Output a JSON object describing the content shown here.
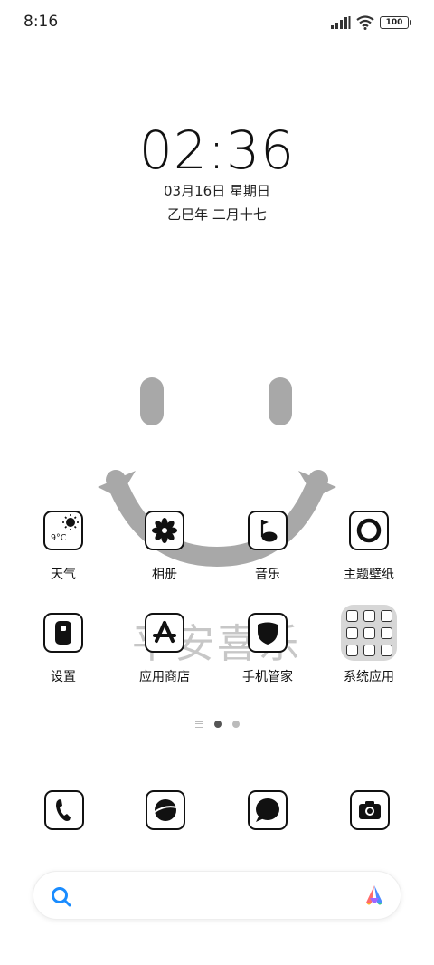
{
  "status_bar": {
    "time": "8:16",
    "battery": "100",
    "icons": [
      "signal-icon",
      "wifi-icon",
      "battery-icon"
    ]
  },
  "clock": {
    "time": "02:36",
    "date": "03月16日 星期日",
    "lunar": "乙巳年 二月十七"
  },
  "wallpaper": {
    "watermark": "平安喜乐"
  },
  "apps": [
    {
      "label": "天气",
      "icon": "weather-icon",
      "temp": "9°C"
    },
    {
      "label": "相册",
      "icon": "gallery-icon"
    },
    {
      "label": "音乐",
      "icon": "music-icon"
    },
    {
      "label": "主题壁纸",
      "icon": "themes-icon"
    },
    {
      "label": "设置",
      "icon": "settings-icon"
    },
    {
      "label": "应用商店",
      "icon": "app-store-icon"
    },
    {
      "label": "手机管家",
      "icon": "security-icon"
    },
    {
      "label": "系统应用",
      "icon": "system-apps-folder-icon"
    }
  ],
  "page_indicator": {
    "pages": 2,
    "active": 0
  },
  "dock": [
    {
      "icon": "phone-icon"
    },
    {
      "icon": "browser-icon"
    },
    {
      "icon": "messages-icon"
    },
    {
      "icon": "camera-icon"
    }
  ],
  "search": {
    "icons": [
      "search-icon",
      "assistant-icon"
    ],
    "colors": {
      "search": "#1a8cff"
    }
  }
}
